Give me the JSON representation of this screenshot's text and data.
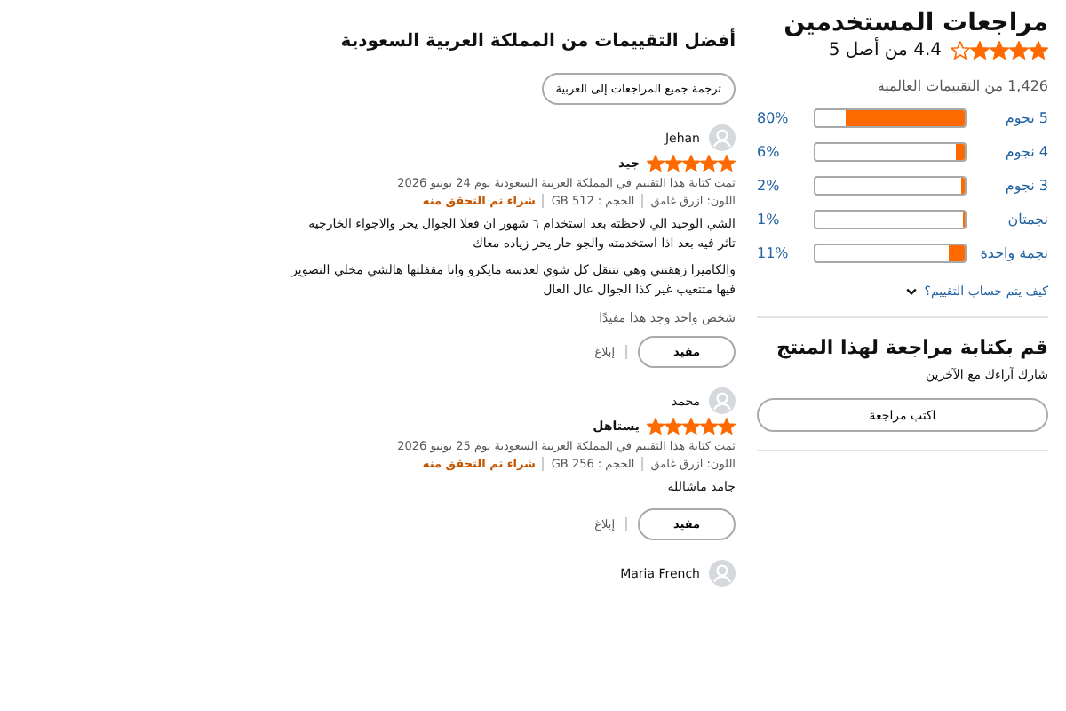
{
  "summary": {
    "title": "مراجعات المستخدمين",
    "stars": 4,
    "score": "4.4 من أصل 5",
    "count": "1,426 من التقييمات العالمية",
    "histogram": [
      {
        "label": "5 نجوم",
        "level": 0.8,
        "percent": "80%"
      },
      {
        "label": "4 نجوم",
        "level": 0.06,
        "percent": "6%"
      },
      {
        "label": "3 نجوم",
        "level": 0.02,
        "percent": "2%"
      },
      {
        "label": "نجمتان",
        "level": 0.01,
        "percent": "1%"
      },
      {
        "label": "نجمة واحدة",
        "level": 0.11,
        "percent": "11%"
      }
    ],
    "how_link": "كيف يتم حساب التقييم؟"
  },
  "write_review": {
    "title": "قم بكتابة مراجعة لهذا المنتج",
    "subtitle": "شارك آراءك مع الآخرين",
    "button": "اكتب مراجعة"
  },
  "top_reviews": {
    "title": "أفضل التقييمات من المملكة العربية السعودية",
    "translate_button": "ترجمة جميع المراجعات إلى العربية",
    "reviews": [
      {
        "author": "Jehan",
        "stars": 5,
        "headline": "جيد",
        "date": "تمت كتابة هذا التقييم في المملكة العربية السعودية يوم 24 يونيو 2026",
        "color_option": "اللون: ازرق غامق",
        "size": "الحجم : GB 512",
        "verified": "شراء تم التحقق منه",
        "paragraphs": [
          "الشي الوحيد الي لاحظته بعد استخدام ٦ شهور ان فعلا الجوال يحر والاجواء الخارجيه تاثر فيه بعد اذا استخدمته والجو حار يحر زياده معاك",
          "والكاميرا زهقتني وهي تتنقل كل شوي لعدسه مايكرو وانا مقفلتها هالشي مخلي التصوير فيها متتعيب غير كذا الجوال عال العال"
        ],
        "helpful_count": "شخص واحد وجد هذا مفيدًا",
        "helpful_button": "مفيد",
        "report": "إبلاغ"
      },
      {
        "author": "محمد",
        "stars": 5,
        "headline": "يستاهل",
        "date": "تمت كتابة هذا التقييم في المملكة العربية السعودية يوم 25 يونيو 2026",
        "color_option": "اللون: ازرق غامق",
        "size": "الحجم : GB 256",
        "verified": "شراء تم التحقق منه",
        "paragraphs": [
          "جامد ماشالله"
        ],
        "helpful_button": "مفيد",
        "report": "إبلاغ"
      },
      {
        "author": "Maria French"
      }
    ]
  }
}
